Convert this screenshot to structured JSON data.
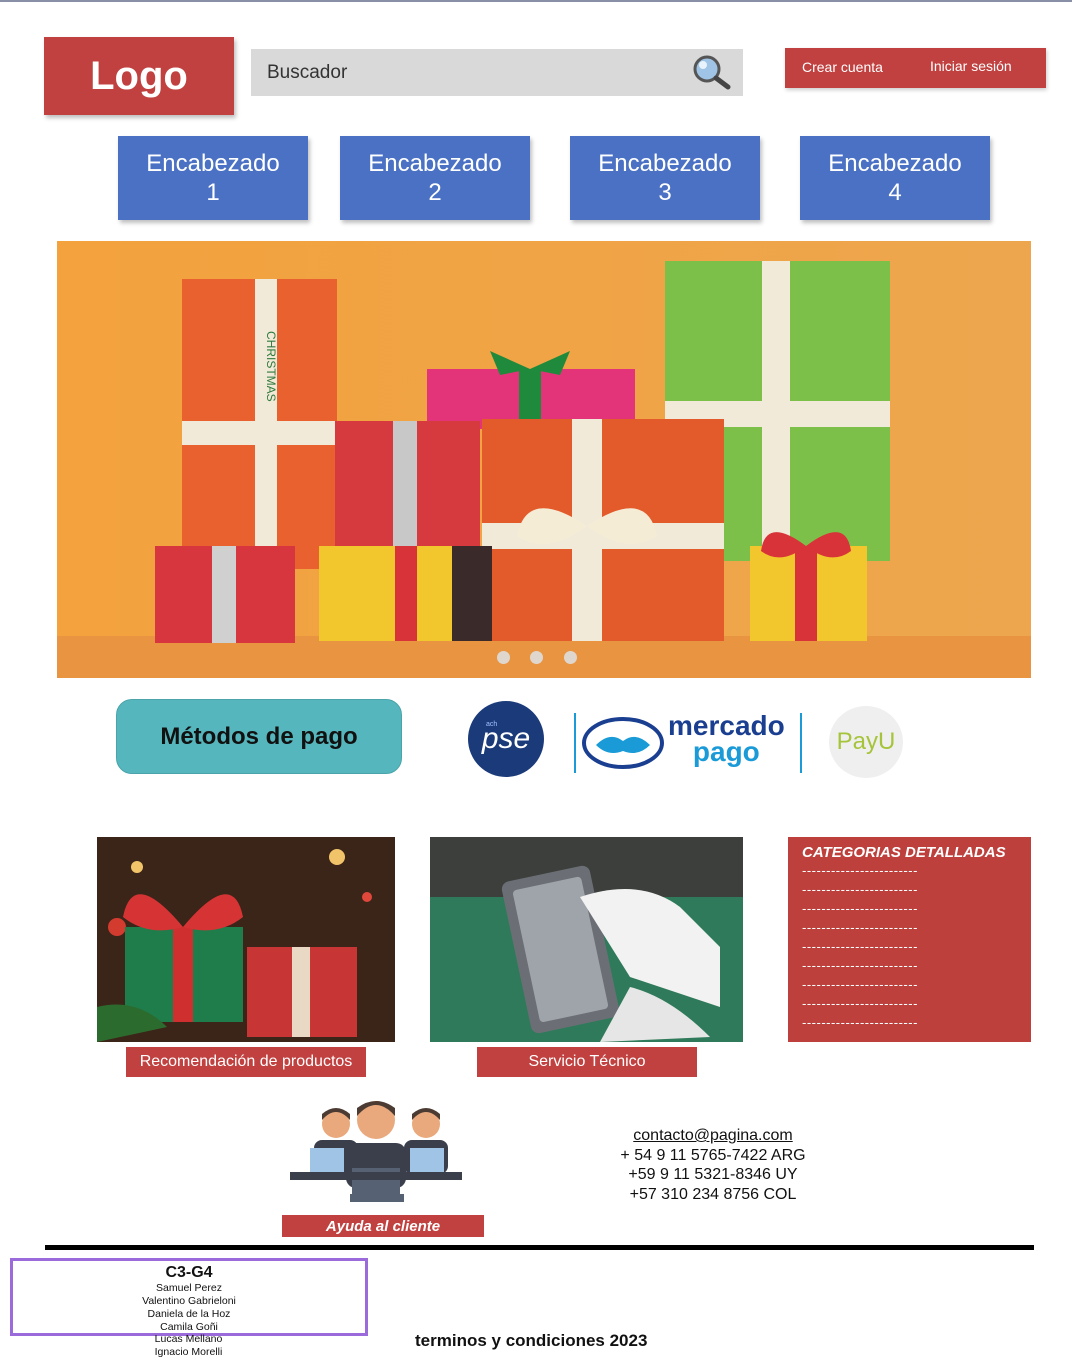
{
  "header": {
    "logo": "Logo",
    "search": {
      "placeholder": "Buscador"
    },
    "create_account": "Crear cuenta",
    "login": "Iniciar sesión"
  },
  "nav": [
    {
      "line1": "Encabezado",
      "line2": "1"
    },
    {
      "line1": "Encabezado",
      "line2": "2"
    },
    {
      "line1": "Encabezado",
      "line2": "3"
    },
    {
      "line1": "Encabezado",
      "line2": "4"
    }
  ],
  "hero": {
    "slides": 3,
    "active_slide": 1,
    "ribbon_text": "CHRISTMAS"
  },
  "payments": {
    "button": "Métodos de pago",
    "pse": {
      "small": "ach",
      "name": "pse"
    },
    "mercadopago": {
      "line1": "mercado",
      "line2": "pago"
    },
    "payu": "PayU"
  },
  "sections": {
    "products_label": "Recomendación de productos",
    "service_label": "Servicio Técnico",
    "categories": {
      "title": "CATEGORIAS DETALLADAS",
      "lines": [
        "------------------------",
        "------------------------",
        "------------------------",
        "------------------------",
        "------------------------",
        "------------------------",
        "------------------------",
        "------------------------",
        "------------------------",
        "------------------------"
      ]
    }
  },
  "support": {
    "label": "Ayuda al cliente",
    "email": "contacto@pagina.com",
    "phones": [
      "+ 54 9 11 5765-7422 ARG",
      "+59 9 11 5321-8346  UY",
      "+57 310 234 8756 COL"
    ]
  },
  "footer": {
    "team_title": "C3-G4",
    "members": [
      "Samuel Perez",
      "Valentino Gabrieloni",
      "Daniela de la Hoz",
      "Camila Goñi",
      "Lucas Mellano",
      "Ignacio Morelli"
    ],
    "terms": "terminos y condiciones 2023"
  },
  "colors": {
    "brand_red": "#c0413f",
    "nav_blue": "#4a71c3",
    "teal": "#55b7bd",
    "team_border": "#9b6bdc"
  }
}
